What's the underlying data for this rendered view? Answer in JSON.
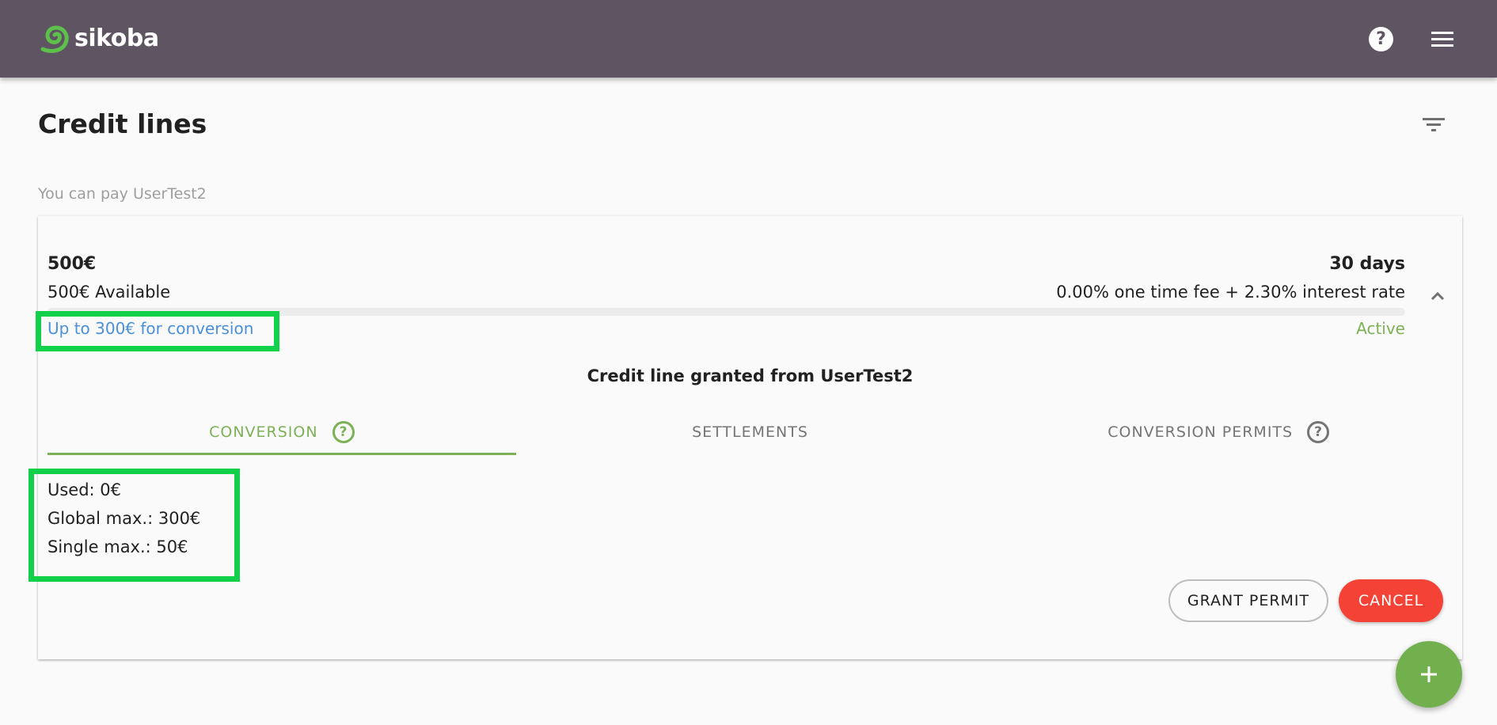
{
  "header": {
    "brand": "sikoba",
    "logo_icon": "spiral-logo-icon",
    "help_icon": "help-circle-icon",
    "help_glyph": "?",
    "menu_icon": "hamburger-menu-icon",
    "colors": {
      "bar": "#5e5462",
      "logo_green": "#5cc04a"
    }
  },
  "page": {
    "title": "Credit lines",
    "filter_icon": "filter-icon",
    "section_label": "You can pay UserTest2"
  },
  "credit_line": {
    "amount": "500€",
    "available": "500€ Available",
    "term": "30 days",
    "rate": "0.00% one time fee + 2.30% interest rate",
    "usage_fraction": 0,
    "conversion_limit": "Up to 300€ for conversion",
    "status": "Active",
    "expand_icon": "chevron-up-icon",
    "granted_label": "Credit line granted from UserTest2",
    "tabs": [
      {
        "label": "CONVERSION",
        "active": true,
        "help_icon": true,
        "help_glyph": "?"
      },
      {
        "label": "SETTLEMENTS",
        "active": false,
        "help_icon": false
      },
      {
        "label": "CONVERSION PERMITS",
        "active": false,
        "help_icon": true,
        "help_glyph": "?"
      }
    ],
    "conversion": {
      "used": "Used: 0€",
      "global_max": "Global max.: 300€",
      "single_max": "Single max.: 50€"
    },
    "actions": {
      "grant_permit": "GRANT PERMIT",
      "cancel": "CANCEL"
    },
    "colors": {
      "accent": "#7cb155",
      "link": "#4a90d9",
      "danger": "#f44336"
    }
  },
  "fab": {
    "icon": "plus-icon",
    "glyph": "+"
  },
  "annotations": {
    "highlight_color": "#11d04a"
  }
}
